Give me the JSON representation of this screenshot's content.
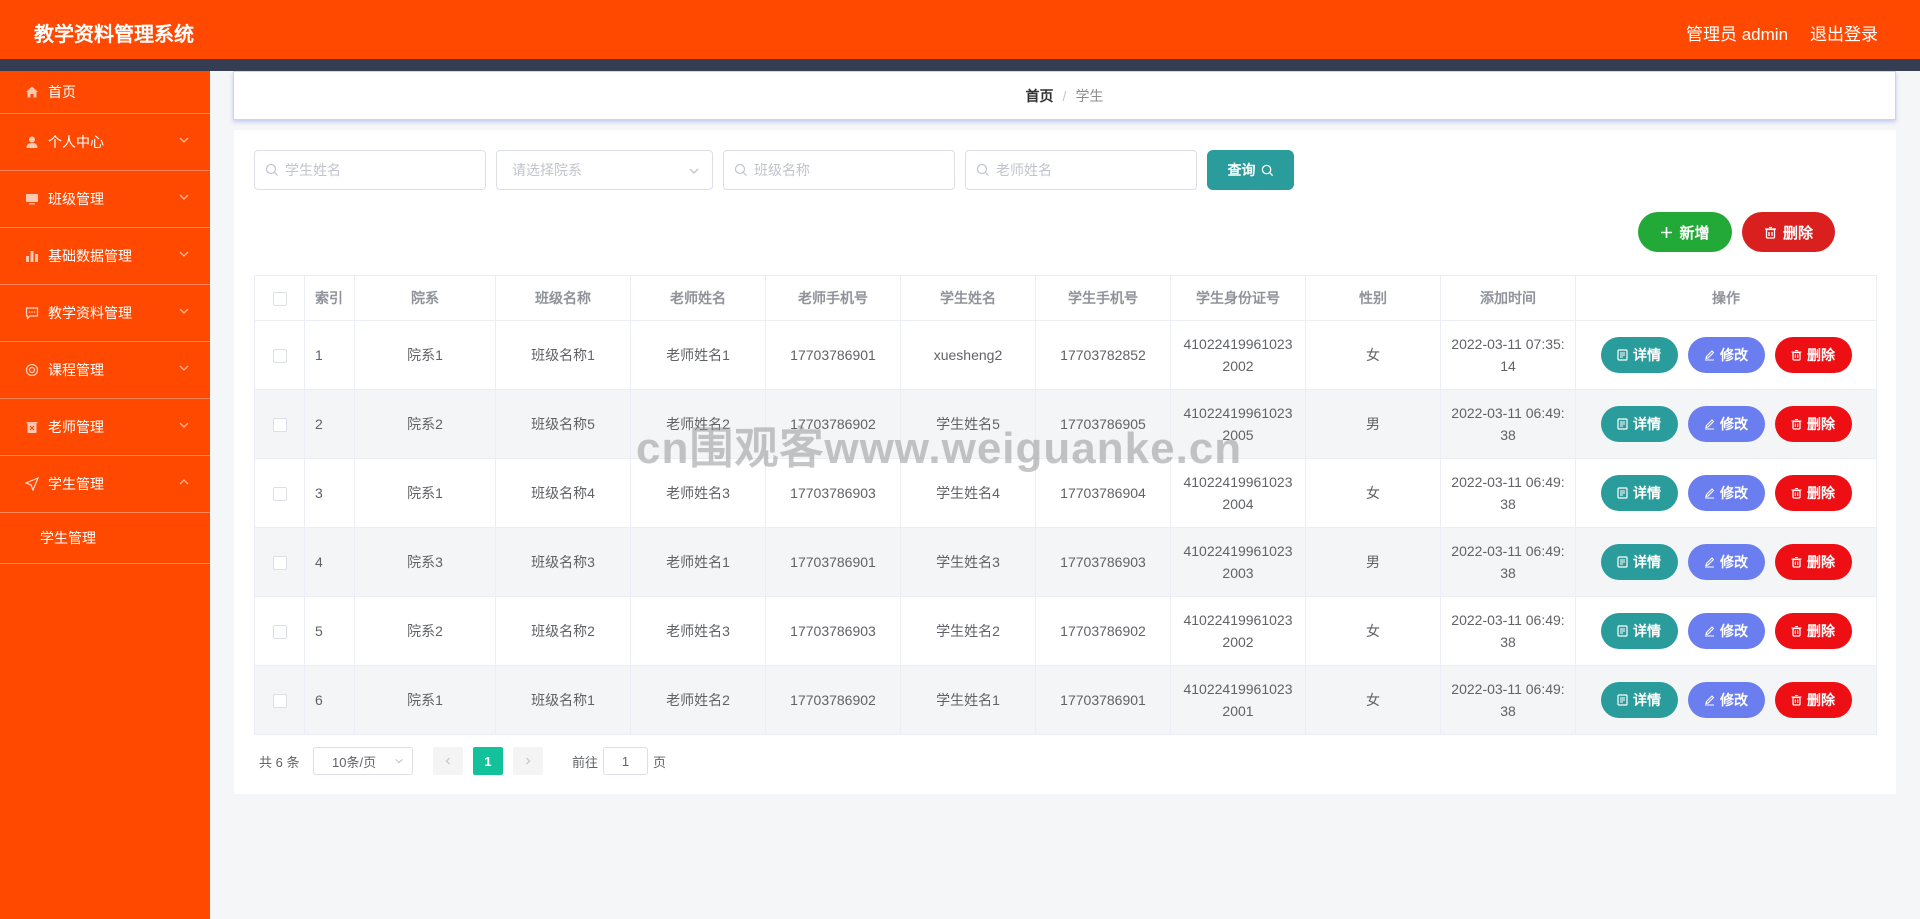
{
  "header": {
    "title": "教学资料管理系统",
    "admin": "管理员 admin",
    "logout": "退出登录"
  },
  "sidebar": {
    "items": [
      {
        "label": "首页",
        "icon": "home-icon"
      },
      {
        "label": "个人中心",
        "icon": "user-icon"
      },
      {
        "label": "班级管理",
        "icon": "monitor-icon"
      },
      {
        "label": "基础数据管理",
        "icon": "bar-chart-icon"
      },
      {
        "label": "教学资料管理",
        "icon": "chat-icon"
      },
      {
        "label": "课程管理",
        "icon": "help-icon"
      },
      {
        "label": "老师管理",
        "icon": "trash-icon"
      },
      {
        "label": "学生管理",
        "icon": "send-icon"
      }
    ],
    "sub_item": "学生管理"
  },
  "breadcrumb": {
    "home": "首页",
    "separator": "/",
    "current": "学生"
  },
  "search": {
    "student_name_placeholder": "学生姓名",
    "department_placeholder": "请选择院系",
    "class_name_placeholder": "班级名称",
    "teacher_name_placeholder": "老师姓名",
    "query_label": "查询"
  },
  "actions": {
    "add_label": "新增",
    "delete_label": "删除"
  },
  "table": {
    "headers": [
      "索引",
      "院系",
      "班级名称",
      "老师姓名",
      "老师手机号",
      "学生姓名",
      "学生手机号",
      "学生身份证号",
      "性别",
      "添加时间",
      "操作"
    ],
    "rows": [
      {
        "idx": "1",
        "dept": "院系1",
        "cls": "班级名称1",
        "teacher": "老师姓名1",
        "tphone": "17703786901",
        "student": "xuesheng2",
        "sphone": "17703782852",
        "id1": "41022419961023",
        "id2": "2002",
        "gender": "女",
        "t1": "2022-03-11 07:35:",
        "t2": "14"
      },
      {
        "idx": "2",
        "dept": "院系2",
        "cls": "班级名称5",
        "teacher": "老师姓名2",
        "tphone": "17703786902",
        "student": "学生姓名5",
        "sphone": "17703786905",
        "id1": "41022419961023",
        "id2": "2005",
        "gender": "男",
        "t1": "2022-03-11 06:49:",
        "t2": "38"
      },
      {
        "idx": "3",
        "dept": "院系1",
        "cls": "班级名称4",
        "teacher": "老师姓名3",
        "tphone": "17703786903",
        "student": "学生姓名4",
        "sphone": "17703786904",
        "id1": "41022419961023",
        "id2": "2004",
        "gender": "女",
        "t1": "2022-03-11 06:49:",
        "t2": "38"
      },
      {
        "idx": "4",
        "dept": "院系3",
        "cls": "班级名称3",
        "teacher": "老师姓名1",
        "tphone": "17703786901",
        "student": "学生姓名3",
        "sphone": "17703786903",
        "id1": "41022419961023",
        "id2": "2003",
        "gender": "男",
        "t1": "2022-03-11 06:49:",
        "t2": "38"
      },
      {
        "idx": "5",
        "dept": "院系2",
        "cls": "班级名称2",
        "teacher": "老师姓名3",
        "tphone": "17703786903",
        "student": "学生姓名2",
        "sphone": "17703786902",
        "id1": "41022419961023",
        "id2": "2002",
        "gender": "女",
        "t1": "2022-03-11 06:49:",
        "t2": "38"
      },
      {
        "idx": "6",
        "dept": "院系1",
        "cls": "班级名称1",
        "teacher": "老师姓名2",
        "tphone": "17703786902",
        "student": "学生姓名1",
        "sphone": "17703786901",
        "id1": "41022419961023",
        "id2": "2001",
        "gender": "女",
        "t1": "2022-03-11 06:49:",
        "t2": "38"
      }
    ],
    "ops": {
      "detail": "详情",
      "edit": "修改",
      "remove": "删除"
    }
  },
  "pagination": {
    "total": "共 6 条",
    "page_size": "10条/页",
    "current_page": "1",
    "goto_label": "前往",
    "goto_value": "1",
    "goto_suffix": "页"
  },
  "watermark": "cn围观客www.weiguanke.cn",
  "colors": {
    "brand": "#ff4800",
    "header_strip": "#353d53",
    "detail": "#2a9c9c",
    "edit": "#6a7ef0",
    "remove": "#ed0f13",
    "add": "#22a937",
    "page_active": "#13c19a"
  }
}
